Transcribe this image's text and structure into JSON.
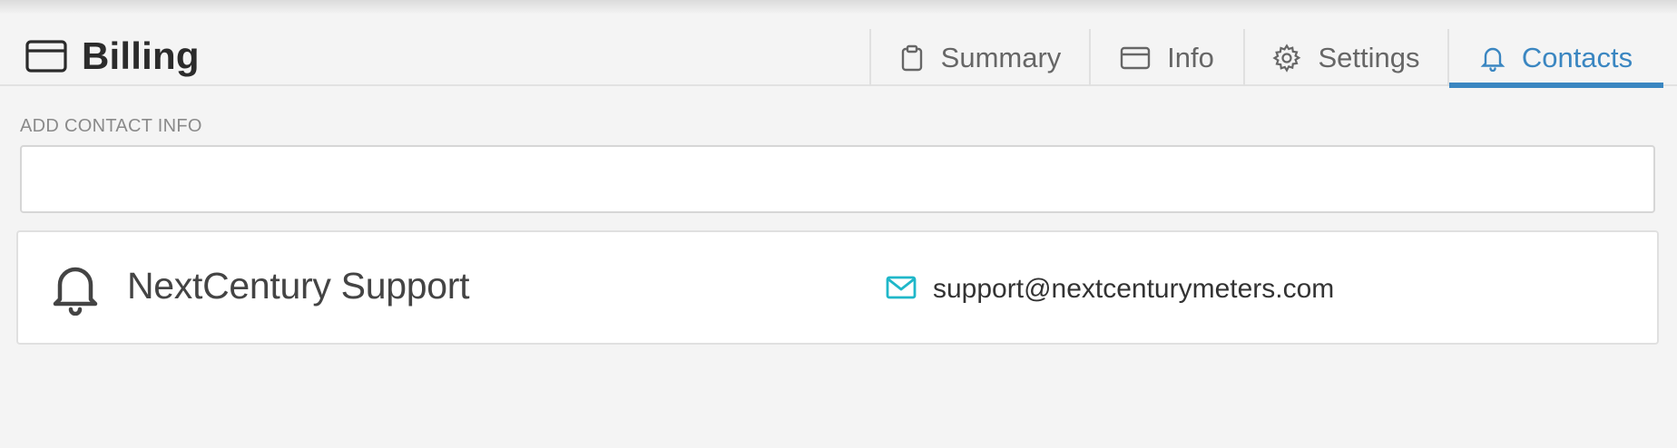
{
  "header": {
    "title": "Billing",
    "title_icon": "credit-card-icon"
  },
  "tabs": [
    {
      "label": "Summary",
      "icon": "clipboard-icon",
      "active": false
    },
    {
      "label": "Info",
      "icon": "credit-card-icon",
      "active": false
    },
    {
      "label": "Settings",
      "icon": "gear-icon",
      "active": false
    },
    {
      "label": "Contacts",
      "icon": "bell-icon",
      "active": true
    }
  ],
  "add_contact": {
    "label": "ADD CONTACT INFO",
    "value": "",
    "placeholder": ""
  },
  "contacts": [
    {
      "name": "NextCentury Support",
      "email": "support@nextcenturymeters.com",
      "icon": "bell-icon",
      "email_icon": "envelope-icon"
    }
  ],
  "colors": {
    "accent": "#3a86c1",
    "email_icon": "#1fb7c9",
    "background": "#f4f4f4"
  }
}
